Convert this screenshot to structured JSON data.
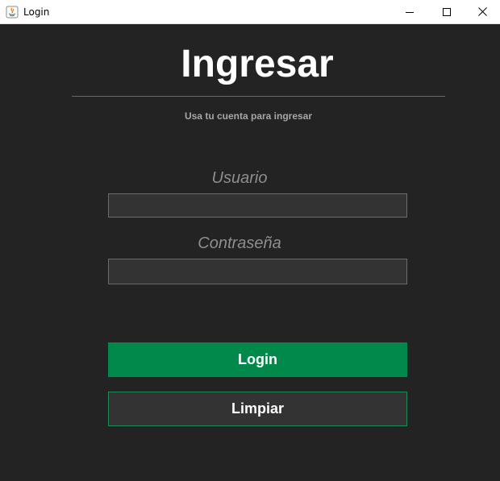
{
  "window": {
    "title": "Login",
    "app_icon": "java-icon"
  },
  "form": {
    "heading": "Ingresar",
    "subtitle": "Usa tu cuenta para ingresar",
    "username_label": "Usuario",
    "username_value": "",
    "password_label": "Contraseña",
    "password_value": "",
    "login_button": "Login",
    "clear_button": "Limpiar"
  },
  "colors": {
    "background": "#232323",
    "field_background": "#333333",
    "accent_green": "#00894a",
    "divider_green": "#2f8a5b",
    "label_gray": "#8e8e8e"
  }
}
